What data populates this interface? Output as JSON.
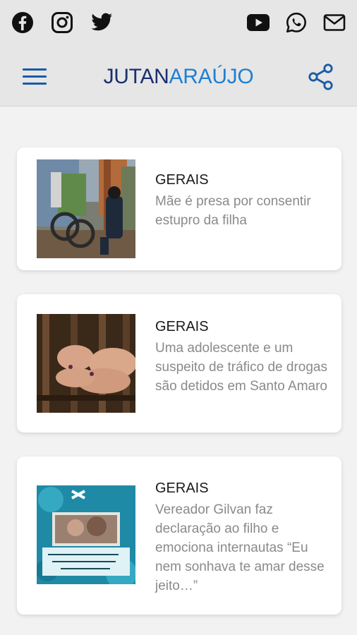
{
  "social_icons": [
    "facebook-icon",
    "instagram-icon",
    "twitter-icon",
    "youtube-icon",
    "whatsapp-icon",
    "mail-icon"
  ],
  "header": {
    "brand_part1": "JUTAN",
    "brand_part2": "ARAÚJO",
    "brand_color_dark": "#1a2f6e",
    "brand_color_light": "#1f7fd1",
    "accent": "#1a5aa8"
  },
  "articles": [
    {
      "category": "GERAIS",
      "title": "Mãe é presa por consentir estupro da filha",
      "thumb": "photo-police-scene"
    },
    {
      "category": "GERAIS",
      "title": "Uma adolescente e um suspeito de tráfico de drogas são detidos em Santo Amaro",
      "thumb": "photo-hands-on-bars"
    },
    {
      "category": "GERAIS",
      "title": "Vereador Gilvan faz declaração ao filho e emociona internautas “Eu nem sonhava te amar desse jeito…”",
      "thumb": "photo-birthday-card"
    }
  ]
}
